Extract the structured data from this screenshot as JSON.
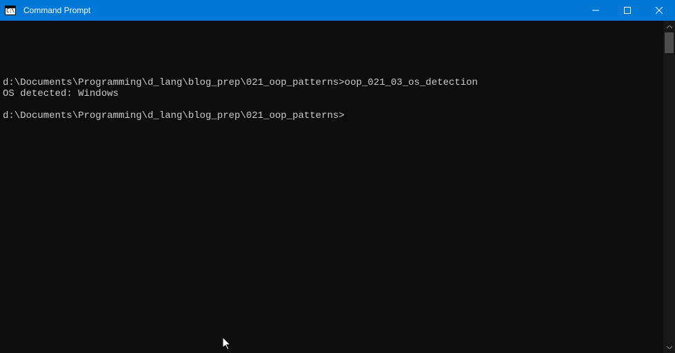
{
  "window": {
    "title": "Command Prompt"
  },
  "terminal": {
    "lines": [
      {
        "prompt": "d:\\Documents\\Programming\\d_lang\\blog_prep\\021_oop_patterns>",
        "command": "oop_021_03_os_detection"
      },
      {
        "output": "OS detected: Windows"
      },
      {
        "blank": true
      },
      {
        "prompt": "d:\\Documents\\Programming\\d_lang\\blog_prep\\021_oop_patterns>",
        "command": ""
      }
    ]
  },
  "controls": {
    "minimize": "Minimize",
    "maximize": "Maximize",
    "close": "Close"
  }
}
